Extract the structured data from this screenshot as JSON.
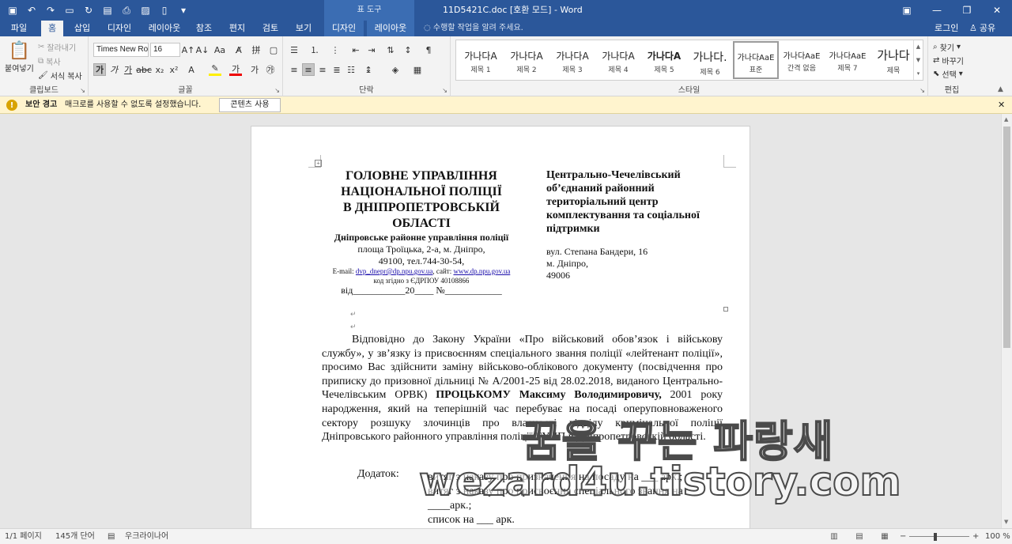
{
  "titlebar": {
    "context_tools": "표 도구",
    "doc_title": "11D5421C.doc [호환 모드] - Word"
  },
  "tabs": [
    {
      "label": "파일"
    },
    {
      "label": "홈"
    },
    {
      "label": "삽입"
    },
    {
      "label": "디자인"
    },
    {
      "label": "레이아웃"
    },
    {
      "label": "참조"
    },
    {
      "label": "편지"
    },
    {
      "label": "검토"
    },
    {
      "label": "보기"
    },
    {
      "label": "디자인"
    },
    {
      "label": "레이아웃"
    }
  ],
  "tell_me": "수행할 작업을 알려 주세요.",
  "account": {
    "login": "로그인",
    "share": "공유"
  },
  "ribbon": {
    "clipboard": {
      "paste": "붙여넣기",
      "cut": "잘라내기",
      "copy": "복사",
      "format_painter": "서식 복사",
      "label": "클립보드"
    },
    "font": {
      "name": "Times New Ro",
      "size": "16",
      "label": "글꼴"
    },
    "paragraph": {
      "label": "단락"
    },
    "styles": {
      "label": "스타일",
      "items": [
        {
          "preview": "가나다A",
          "name": "제목 1"
        },
        {
          "preview": "가나다A",
          "name": "제목 2"
        },
        {
          "preview": "가나다A",
          "name": "제목 3"
        },
        {
          "preview": "가나다A",
          "name": "제목 4"
        },
        {
          "preview": "가나다A",
          "name": "제목 5"
        },
        {
          "preview": "가나다.",
          "name": "제목 6"
        },
        {
          "preview": "가나다AaE",
          "name": "표준"
        },
        {
          "preview": "가나다AaE",
          "name": "간격 없음"
        },
        {
          "preview": "가나다AaE",
          "name": "제목 7"
        },
        {
          "preview": "가나다",
          "name": "제목"
        }
      ]
    },
    "editing": {
      "find": "찾기",
      "replace": "바꾸기",
      "select": "선택",
      "label": "편집"
    }
  },
  "message_bar": {
    "title": "보안 경고",
    "text": "매크로를 사용할 수 없도록 설정했습니다.",
    "button": "콘텐츠 사용"
  },
  "document": {
    "left_header": {
      "org1": "ГОЛОВНЕ УПРАВЛІННЯ",
      "org2": "НАЦІОНАЛЬНОЇ ПОЛІЦІЇ",
      "org3": "В ДНІПРОПЕТРОВСЬКІЙ",
      "org4": "ОБЛАСТІ",
      "dept": "Дніпровське районне управління поліції",
      "addr1": "площа Троїцька, 2-а, м. Дніпро,",
      "addr2": "49100, тел.744-30-54,",
      "email_label": "E-mail: ",
      "email": "dvp_dnepr@dp.npu.gov.ua",
      "site_label": ", сайт: ",
      "site": "www.dp.npu.gov.ua",
      "edrpou": "код згідно з ЄДРПОУ 40108866",
      "date_line": "від___________20____ №____________"
    },
    "right_header": {
      "l1": "Центрально-Чечелівський",
      "l2": "об’єднаний районний",
      "l3": "територіальний центр",
      "l4": "комплектування та соціальної",
      "l5": "підтримки",
      "a1": "вул. Степана Бандери, 16",
      "a2": "м. Дніпро,",
      "a3": "49006"
    },
    "body": {
      "p1": "Відповідно до Закону України  «Про військовий обов’язок і військову службу», у зв’язку із присвоєнням спеціального звання поліції «лейтенант поліції», просимо Вас здійснити заміну військово-облікового документу (посвідчення про приписку до призовної дільниці № А/2001-25  від 28.02.2018, виданого Центрально-Чечелівським ОРВК) ",
      "name": "ПРОЦЬКОМУ Максиму Володимировичу,",
      "p2": " 2001 року народження, який на теперішній час перебуває на посаді оперуповноваженого сектору розшуку злочинців про власності відділу кримінальної поліції Дніпровського районного управління поліції ГУНП в Дніпропетровській області."
    },
    "attachments": {
      "label": "Додаток:",
      "a1": "витяг з наказу про призначення на посаду на ___ арк.;",
      "a2a": "витяг з наказу про присвоєння спеціального звання на",
      "a2b": "____арк.;",
      "a3": "список на ___ арк."
    }
  },
  "watermark": {
    "line1": "꿈을 꾸는 파랑새",
    "line2": "wezard4u.tistory.com"
  },
  "statusbar": {
    "page": "1/1 페이지",
    "words": "145개 단어",
    "lang": "우크라이나어",
    "zoom": "100 %"
  }
}
